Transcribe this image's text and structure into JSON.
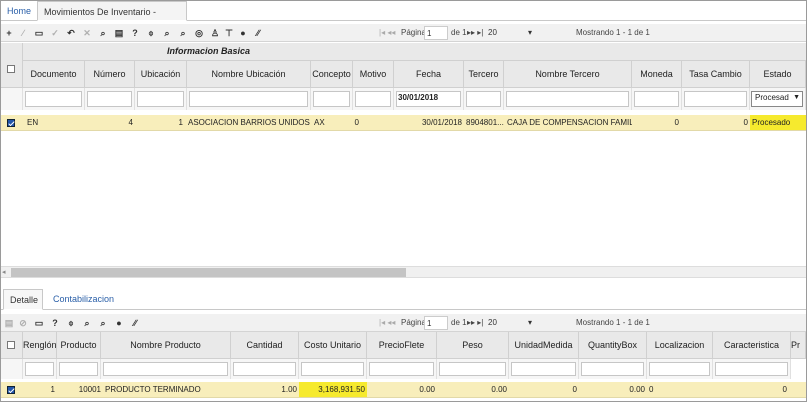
{
  "tabs": {
    "home": "Home",
    "active": "Movimientos De Inventario -[imov]",
    "close": "×"
  },
  "toolbar1": {
    "icons": [
      "+",
      "∕",
      "▭",
      "✓",
      "↶",
      "✕",
      "⌕",
      "▤",
      "?",
      "⌽",
      "⌕",
      "⌕",
      "◎",
      "♙",
      "⊤",
      "●",
      "∕∕"
    ],
    "pager": {
      "page_label": "Página",
      "page_value": "1",
      "of_label": "de 1",
      "rows": "20",
      "showing": "Mostrando 1 - 1 de 1"
    }
  },
  "master": {
    "group_header": "Informacion Basica",
    "columns": [
      "Documento",
      "Número",
      "Ubicación",
      "Nombre Ubicación",
      "Concepto",
      "Motivo",
      "Fecha",
      "Tercero",
      "Nombre Tercero",
      "Moneda",
      "Tasa Cambio",
      "Estado"
    ],
    "filter": {
      "fecha": "30/01/2018",
      "estado": "Procesad"
    },
    "rows": [
      {
        "documento": "EN",
        "numero": "4",
        "ubicacion": "1",
        "nombre_ubicacion": "ASOCIACION BARRIOS UNIDOS D...",
        "concepto": "AX",
        "motivo": "0",
        "fecha": "30/01/2018",
        "tercero": "8904801...",
        "nombre_tercero": "CAJA DE COMPENSACION FAMILI...",
        "moneda": "0",
        "tasa_cambio": "0",
        "estado": "Procesado"
      }
    ]
  },
  "detail_tabs": {
    "detalle": "Detalle",
    "contabilizacion": "Contabilizacion"
  },
  "toolbar2": {
    "icons": [
      "▤",
      "⊘",
      "▭",
      "?",
      "⌽",
      "⌕",
      "⌕",
      "●",
      "∕∕"
    ],
    "pager": {
      "page_label": "Página",
      "page_value": "1",
      "of_label": "de 1",
      "rows": "20",
      "showing": "Mostrando 1 - 1 de 1"
    }
  },
  "detail": {
    "columns": [
      "Renglón",
      "Producto",
      "Nombre Producto",
      "Cantidad",
      "Costo Unitario",
      "PrecioFlete",
      "Peso",
      "UnidadMedida",
      "QuantityBox",
      "Localizacion",
      "Caracteristica",
      "Pr"
    ],
    "rows": [
      {
        "renglon": "1",
        "producto": "10001",
        "nombre_producto": "PRODUCTO TERMINADO",
        "cantidad": "1.00",
        "costo_unitario": "3,168,931.50",
        "precio_flete": "0.00",
        "peso": "0.00",
        "unidad_medida": "0",
        "quantity_box": "0.00",
        "localizacion": "0",
        "caracteristica": "0"
      }
    ]
  },
  "colors": {
    "row_highlight": "#f8eebb",
    "cell_highlight": "#f6ea2e",
    "link": "#2a5fa8"
  }
}
